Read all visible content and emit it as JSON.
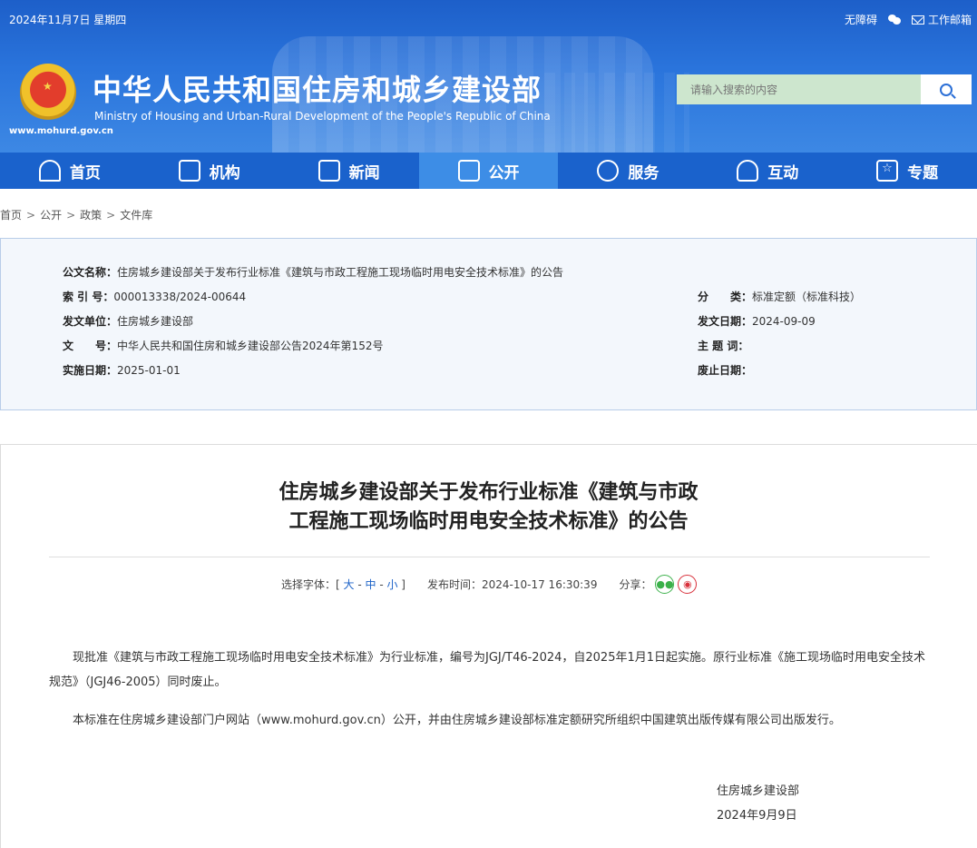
{
  "header": {
    "date": "2024年11月7日 星期四",
    "links": [
      {
        "label": "无障碍",
        "icon": "accessibility-link"
      },
      {
        "label": "",
        "icon": "wechat-icon"
      },
      {
        "label": "工作邮箱",
        "icon": "mail-icon"
      }
    ],
    "ministry_cn": "中华人民共和国住房和城乡建设部",
    "ministry_en": "Ministry of Housing and Urban-Rural Development of the People's Republic of China",
    "site_url": "www.mohurd.gov.cn",
    "search_placeholder": "请输入搜索的内容"
  },
  "nav": [
    {
      "label": "首页",
      "icon": "home-icon"
    },
    {
      "label": "机构",
      "icon": "building-icon"
    },
    {
      "label": "新闻",
      "icon": "news-icon"
    },
    {
      "label": "公开",
      "icon": "disclosure-icon",
      "active": true
    },
    {
      "label": "服务",
      "icon": "service-icon"
    },
    {
      "label": "互动",
      "icon": "interact-icon"
    },
    {
      "label": "专题",
      "icon": "star-icon"
    }
  ],
  "breadcrumb": [
    "首页",
    "公开",
    "政策",
    "文件库"
  ],
  "meta": {
    "doc_name_label": "公文名称：",
    "doc_name": "住房城乡建设部关于发布行业标准《建筑与市政工程施工现场临时用电安全技术标准》的公告",
    "index_label": "索 引 号：",
    "index": "000013338/2024-00644",
    "category_label": "分　　类：",
    "category": "标准定额（标准科技）",
    "issuer_label": "发文单位：",
    "issuer": "住房城乡建设部",
    "issue_date_label": "发文日期：",
    "issue_date": "2024-09-09",
    "doc_no_label": "文　　号：",
    "doc_no": "中华人民共和国住房和城乡建设部公告2024年第152号",
    "keywords_label": "主 题 词：",
    "keywords": "",
    "effective_label": "实施日期：",
    "effective": "2025-01-01",
    "repeal_label": "废止日期：",
    "repeal": ""
  },
  "article": {
    "title_line1": "住房城乡建设部关于发布行业标准《建筑与市政",
    "title_line2": "工程施工现场临时用电安全技术标准》的公告",
    "font_label": "选择字体：[ ",
    "font_large": "大",
    "font_medium": "中",
    "font_small": "小",
    "font_close": " ]",
    "publish_label": "发布时间：",
    "publish_time": "2024-10-17 16:30:39",
    "share_label": "分享：",
    "para1": "现批准《建筑与市政工程施工现场临时用电安全技术标准》为行业标准，编号为JGJ/T46-2024，自2025年1月1日起实施。原行业标准《施工现场临时用电安全技术规范》（JGJ46-2005）同时废止。",
    "para2": "本标准在住房城乡建设部门户网站（www.mohurd.gov.cn）公开，并由住房城乡建设部标准定额研究所组织中国建筑出版传媒有限公司出版发行。",
    "sign_org": "住房城乡建设部",
    "sign_date": "2024年9月9日"
  },
  "colors": {
    "header_blue": "#2a74dc",
    "nav_blue": "#1a62cc",
    "nav_active": "#3d8de6",
    "search_bg": "#cde6ce",
    "link_blue": "#1d63c8"
  }
}
